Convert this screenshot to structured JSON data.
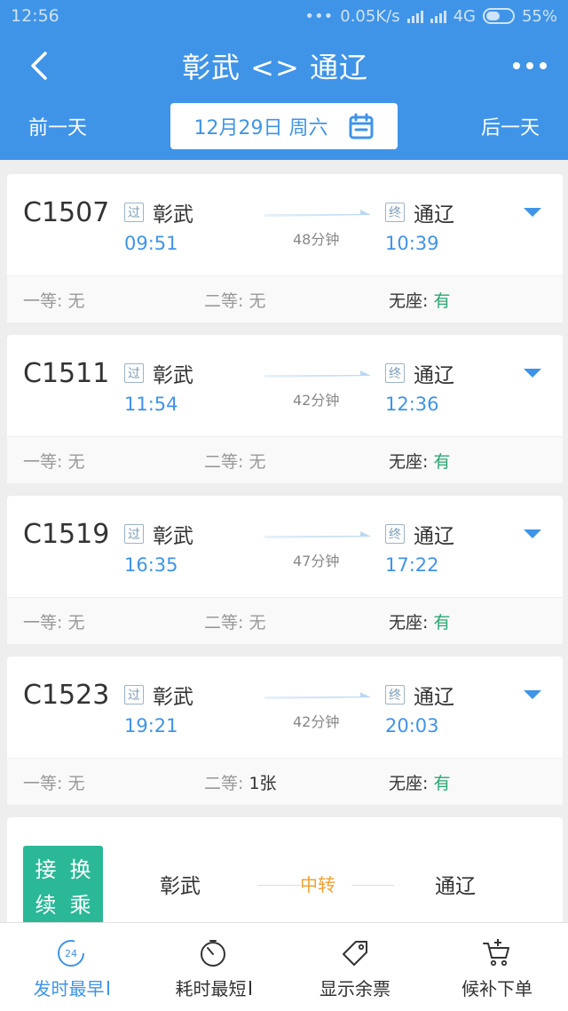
{
  "status_bar": {
    "time": "12:56",
    "net_speed": "0.05K/s",
    "network": "4G",
    "battery": "55%"
  },
  "header": {
    "title": "彰武 <> 通辽",
    "prev_day": "前一天",
    "next_day": "后一天",
    "date": "12月29日 周六"
  },
  "trains": [
    {
      "no": "C1507",
      "from_tag": "过",
      "from": "彰武",
      "dep": "09:51",
      "duration": "48分钟",
      "to_tag": "终",
      "to": "通辽",
      "arr": "10:39",
      "seat1_label": "一等:",
      "seat1_val": "无",
      "seat2_label": "二等:",
      "seat2_val": "无",
      "seat3_label": "无座:",
      "seat3_val": "有"
    },
    {
      "no": "C1511",
      "from_tag": "过",
      "from": "彰武",
      "dep": "11:54",
      "duration": "42分钟",
      "to_tag": "终",
      "to": "通辽",
      "arr": "12:36",
      "seat1_label": "一等:",
      "seat1_val": "无",
      "seat2_label": "二等:",
      "seat2_val": "无",
      "seat3_label": "无座:",
      "seat3_val": "有"
    },
    {
      "no": "C1519",
      "from_tag": "过",
      "from": "彰武",
      "dep": "16:35",
      "duration": "47分钟",
      "to_tag": "终",
      "to": "通辽",
      "arr": "17:22",
      "seat1_label": "一等:",
      "seat1_val": "无",
      "seat2_label": "二等:",
      "seat2_val": "无",
      "seat3_label": "无座:",
      "seat3_val": "有"
    },
    {
      "no": "C1523",
      "from_tag": "过",
      "from": "彰武",
      "dep": "19:21",
      "duration": "42分钟",
      "to_tag": "终",
      "to": "通辽",
      "arr": "20:03",
      "seat1_label": "一等:",
      "seat1_val": "无",
      "seat2_label": "二等:",
      "seat2_val": "1张",
      "seat3_label": "无座:",
      "seat3_val": "有"
    }
  ],
  "transfer": {
    "badge": [
      "接",
      "换",
      "续",
      "乘"
    ],
    "from": "彰武",
    "via": "中转",
    "to": "通辽"
  },
  "bottom_tabs": [
    {
      "label": "发时最早",
      "icon": "clock-24-icon",
      "badge": "24"
    },
    {
      "label": "耗时最短",
      "icon": "stopwatch-icon"
    },
    {
      "label": "显示余票",
      "icon": "ticket-tag-icon"
    },
    {
      "label": "候补下单",
      "icon": "cart-plus-icon"
    }
  ],
  "colors": {
    "primary": "#3f94e8",
    "available": "#2aa773",
    "transfer": "#2ab897",
    "via": "#f0a030"
  }
}
